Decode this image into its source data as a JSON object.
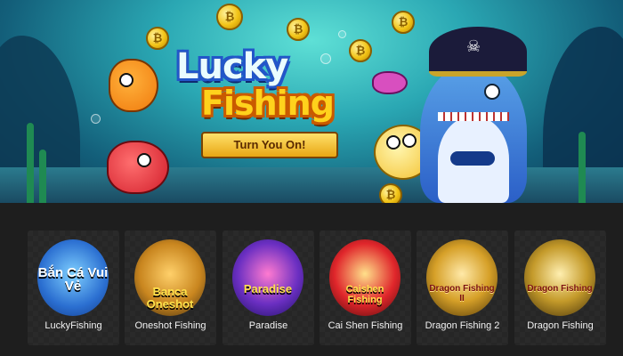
{
  "banner": {
    "logo_word1": "Lucky",
    "logo_word2": "Fishing",
    "tagline": "Turn You On!",
    "coin_glyph": "₿"
  },
  "games": [
    {
      "title": "LuckyFishing",
      "thumb_text": "Bắn Cá Vui Vẻ"
    },
    {
      "title": "Oneshot Fishing",
      "thumb_text": "Banca Oneshot"
    },
    {
      "title": "Paradise",
      "thumb_text": "Paradise"
    },
    {
      "title": "Cai Shen Fishing",
      "thumb_text": "Caishen Fishing"
    },
    {
      "title": "Dragon Fishing 2",
      "thumb_text": "Dragon Fishing II"
    },
    {
      "title": "Dragon Fishing",
      "thumb_text": "Dragon Fishing"
    }
  ],
  "colors": {
    "page_bg": "#1c1c1c",
    "card_bg": "#2a2a2a",
    "logo_blue": "#2256c9",
    "logo_gold": "#ffd21c"
  }
}
